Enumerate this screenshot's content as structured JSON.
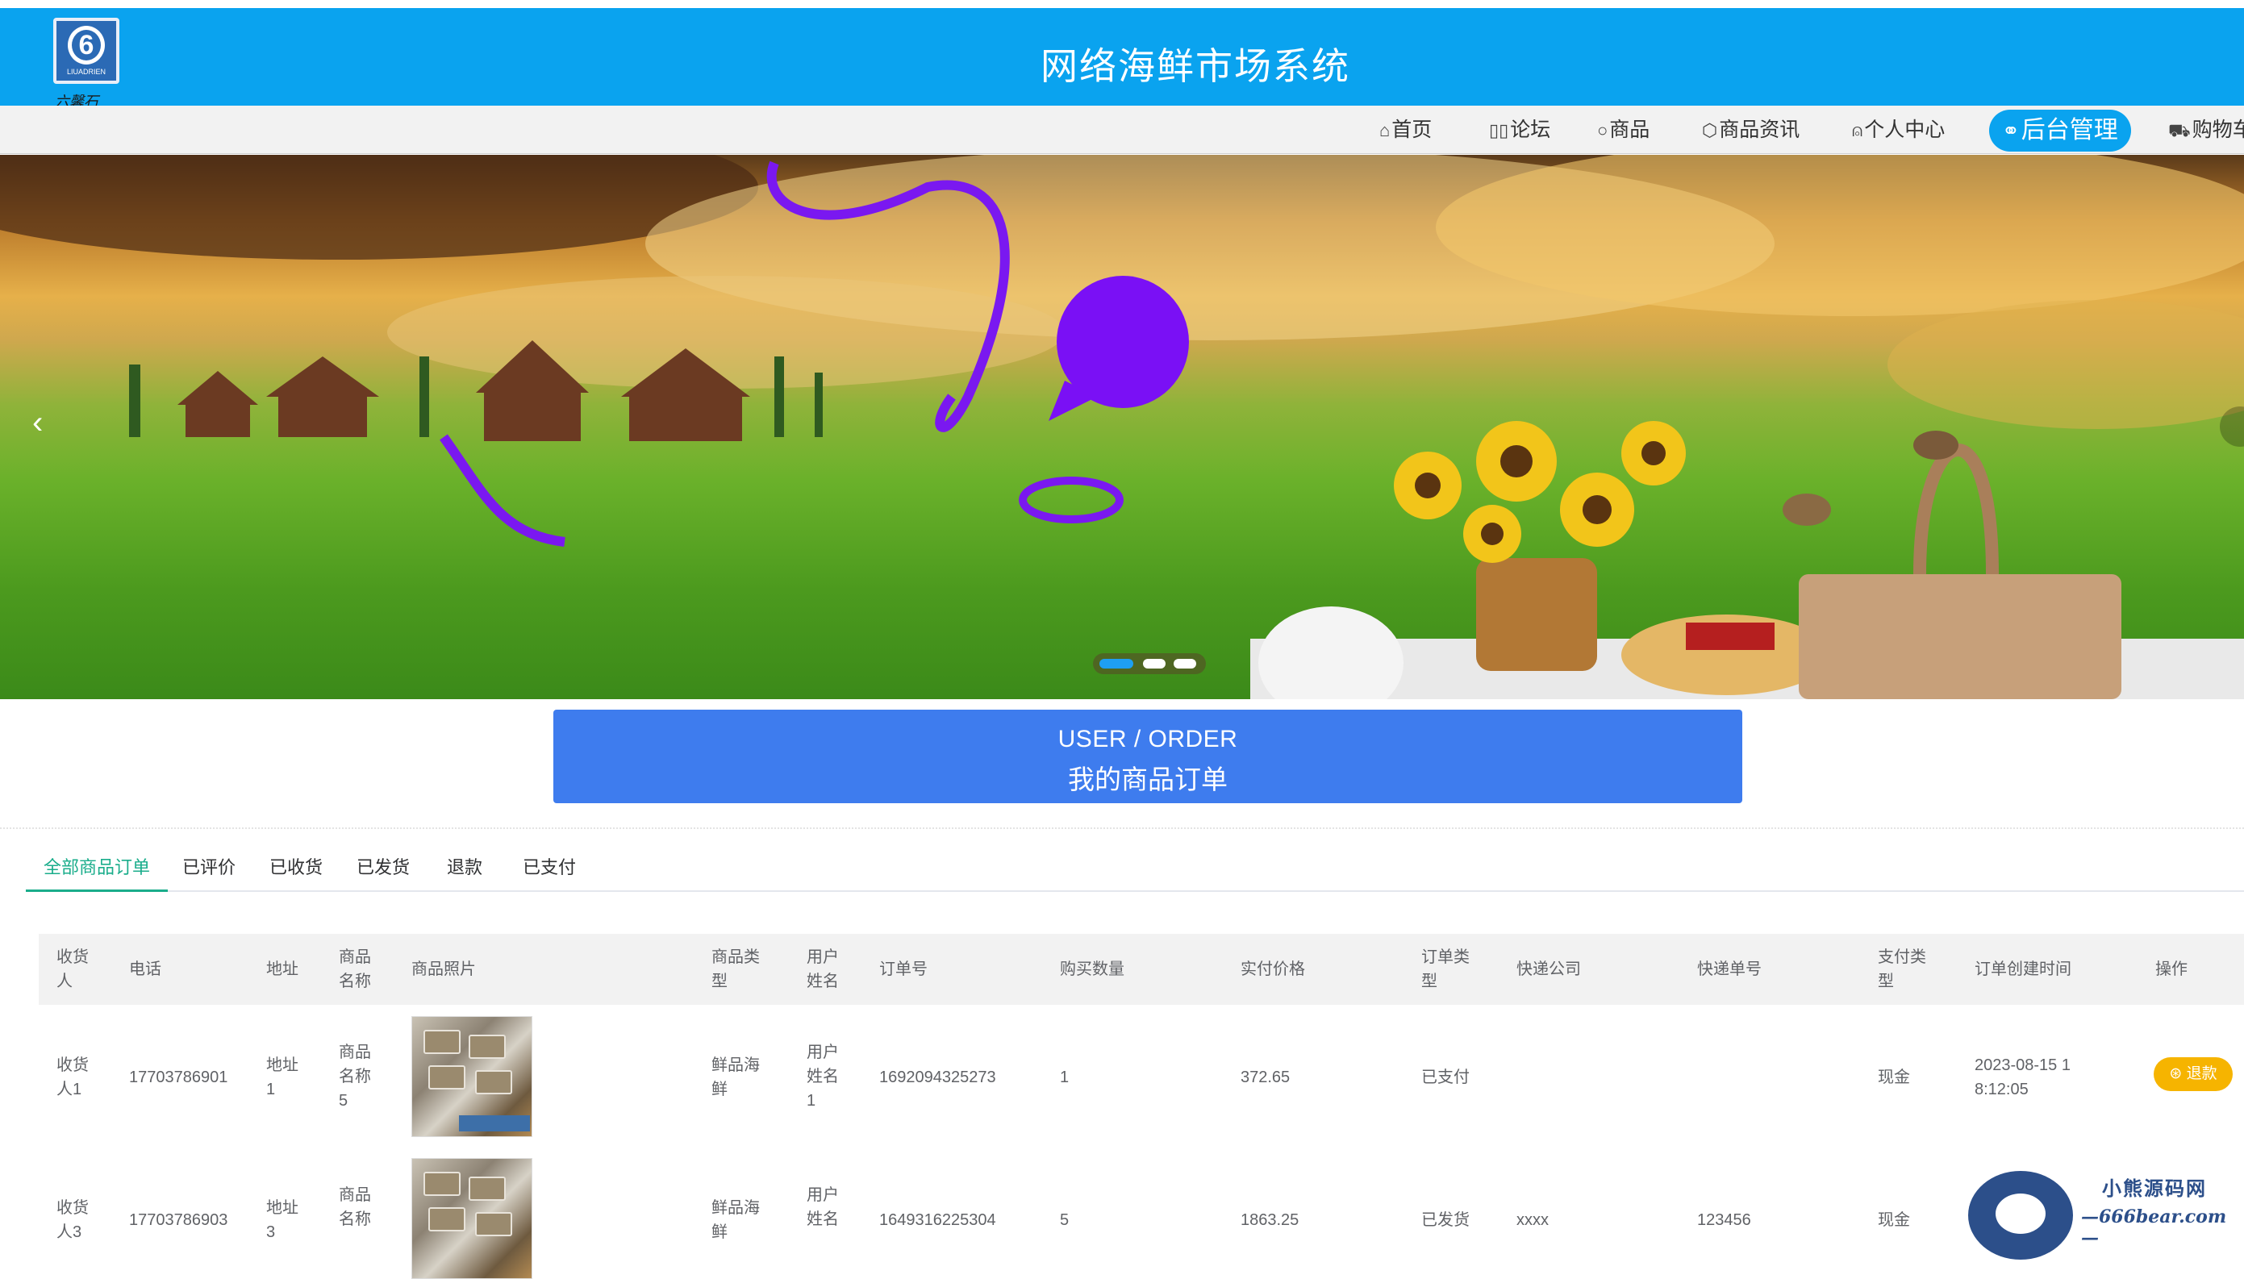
{
  "header": {
    "title": "网络海鲜市场系统",
    "logo_mark": "6",
    "logo_text": "LIUADRIEN",
    "logo_script": "六馨石"
  },
  "nav": {
    "items": [
      {
        "label": "首页",
        "icon": "home-icon",
        "glyph": "⌂"
      },
      {
        "label": "论坛",
        "icon": "forum-icon",
        "glyph": "▯▯"
      },
      {
        "label": "商品",
        "icon": "goods-icon",
        "glyph": "○"
      },
      {
        "label": "商品资讯",
        "icon": "news-icon",
        "glyph": "⬡"
      },
      {
        "label": "个人中心",
        "icon": "user-icon",
        "glyph": "⍝"
      },
      {
        "label": "后台管理",
        "icon": "link-icon",
        "glyph": "⚭"
      },
      {
        "label": "购物车",
        "icon": "cart-icon",
        "glyph": "⛟"
      }
    ],
    "active_index": 5
  },
  "carousel": {
    "slides": 3,
    "active_slide": 1
  },
  "section": {
    "title_en": "USER / ORDER",
    "title_cn": "我的商品订单"
  },
  "tabs": [
    "全部商品订单",
    "已评价",
    "已收货",
    "已发货",
    "退款",
    "已支付"
  ],
  "active_tab": 0,
  "table": {
    "headers": [
      "收货人",
      "电话",
      "地址",
      "商品名称",
      "商品照片",
      "商品类型",
      "用户姓名",
      "订单号",
      "购买数量",
      "实付价格",
      "订单类型",
      "快递公司",
      "快递单号",
      "支付类型",
      "订单创建时间",
      "操作"
    ],
    "rows": [
      {
        "receiver": "收货人1",
        "phone": "17703786901",
        "address": "地址1",
        "product": "商品名称5",
        "type": "鲜品海鲜",
        "user": "用户姓名1",
        "order_no": "1692094325273",
        "qty": "1",
        "price": "372.65",
        "status": "已支付",
        "courier": "",
        "tracking": "",
        "pay_type": "现金",
        "created": "2023-08-15 18:12:05",
        "action": "退款"
      },
      {
        "receiver": "收货人3",
        "phone": "17703786903",
        "address": "地址3",
        "product": "商品名称",
        "type": "鲜品海鲜",
        "user": "用户姓名",
        "order_no": "1649316225304",
        "qty": "5",
        "price": "1863.25",
        "status": "已发货",
        "courier": "xxxx",
        "tracking": "123456",
        "pay_type": "现金",
        "created": "",
        "action": ""
      }
    ]
  },
  "watermark": {
    "name": "小熊源码网",
    "url": "—666bear.com—"
  }
}
